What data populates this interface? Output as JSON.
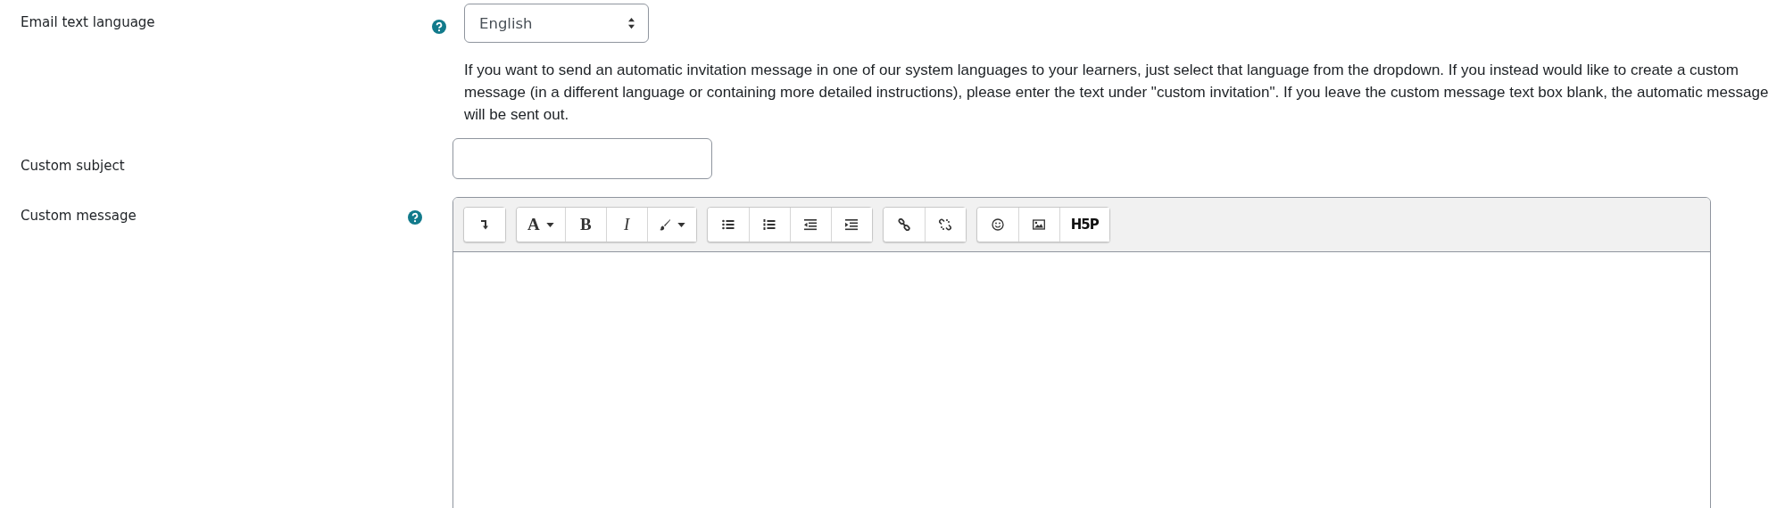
{
  "fields": [
    {
      "kind": "select",
      "label": "Email text language",
      "help": true,
      "value": "English",
      "description": "If you want to send an automatic invitation message in one of our system languages to your learners, just select that language from the dropdown. If you instead would like to create a custom message (in a different language or containing more detailed instructions), please enter the text under \"custom invitation\". If you leave the custom message text box blank, the automatic message will be sent out."
    },
    {
      "kind": "text",
      "label": "Custom subject",
      "help": false
    },
    {
      "kind": "editor",
      "label": "Custom message",
      "help": true,
      "toolbar": [
        [
          {
            "kind": "collapse"
          }
        ],
        [
          {
            "kind": "font",
            "label": "A"
          },
          {
            "kind": "bold",
            "label": "B"
          },
          {
            "kind": "italic",
            "label": "I"
          },
          {
            "kind": "brush"
          }
        ],
        [
          {
            "kind": "bullets"
          },
          {
            "kind": "numbers"
          },
          {
            "kind": "outdent"
          },
          {
            "kind": "indent"
          }
        ],
        [
          {
            "kind": "link"
          },
          {
            "kind": "unlink"
          }
        ],
        [
          {
            "kind": "emoji"
          },
          {
            "kind": "image"
          },
          {
            "kind": "h5p",
            "label": "H5P"
          }
        ]
      ]
    }
  ]
}
